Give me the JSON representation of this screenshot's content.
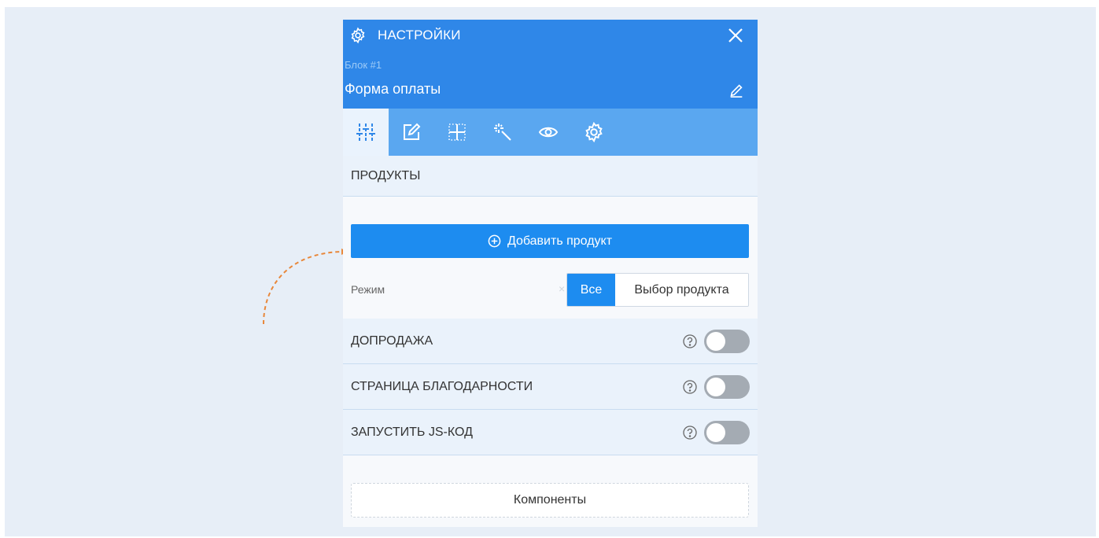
{
  "header": {
    "title": "НАСТРОЙКИ",
    "block_label": "Блок #1",
    "block_name": "Форма оплаты",
    "icons": {
      "settings": "gear-icon",
      "close": "close-icon",
      "edit": "pencil-icon"
    }
  },
  "toolbar": {
    "tabs": [
      {
        "icon": "sliders-icon",
        "active": true
      },
      {
        "icon": "edit-icon",
        "active": false
      },
      {
        "icon": "grid-icon",
        "active": false
      },
      {
        "icon": "magic-wand-icon",
        "active": false
      },
      {
        "icon": "eye-icon",
        "active": false
      },
      {
        "icon": "gear-icon",
        "active": false
      }
    ]
  },
  "products": {
    "heading": "ПРОДУКТЫ",
    "add_button": "Добавить продукт",
    "mode_label": "Режим",
    "mode_clear": "×",
    "mode_options": [
      "Все",
      "Выбор продукта"
    ],
    "mode_selected": "Все"
  },
  "toggles": [
    {
      "label": "ДОПРОДАЖА",
      "on": false
    },
    {
      "label": "СТРАНИЦА БЛАГОДАРНОСТИ",
      "on": false
    },
    {
      "label": "ЗАПУСТИТЬ JS-КОД",
      "on": false
    }
  ],
  "components_button": "Компоненты",
  "colors": {
    "header": "#2f87e8",
    "toolbar": "#5aa7f0",
    "primary": "#1d8cf0",
    "background": "#e7eef7",
    "arrow": "#e8873a"
  }
}
